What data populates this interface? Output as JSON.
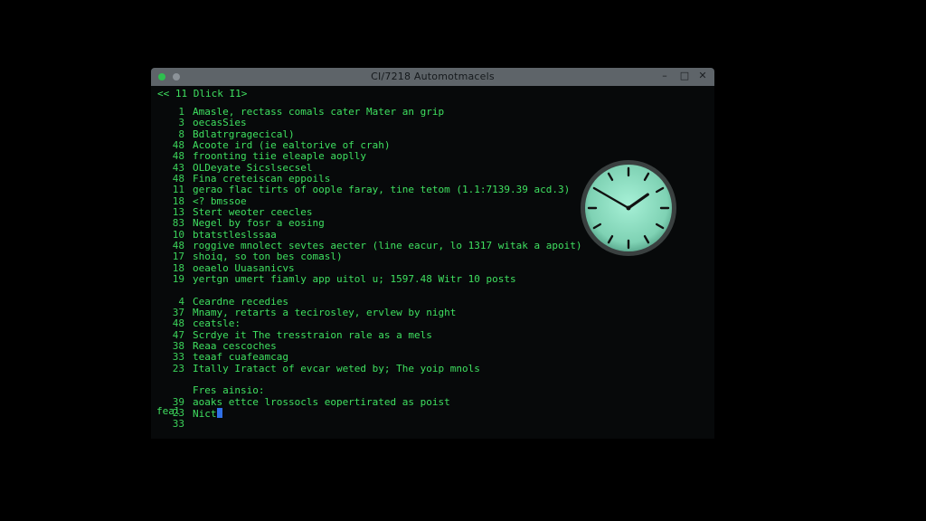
{
  "window": {
    "title": "CI/7218 Automotmacels",
    "controls": {
      "minimize": "–",
      "maximize": "□",
      "close": "✕"
    }
  },
  "terminal": {
    "header": "<< 11 Dlick I1>",
    "lines": [
      {
        "num": "1",
        "text": "Amasle, rectass comals cater Mater an grip"
      },
      {
        "num": "3",
        "text": "oecasSies"
      },
      {
        "num": "8",
        "text": "Bdlatrgragecical)"
      },
      {
        "num": "48",
        "text": "Acoote ird (ie ealtorive of crah)"
      },
      {
        "num": "48",
        "text": "froonting tiie eleaple aoplly"
      },
      {
        "num": "43",
        "text": "OLDeyate Sicslsecsel"
      },
      {
        "num": "48",
        "text": "Fina creteiscan eppoils"
      },
      {
        "num": "11",
        "text": "gerao flac tirts of oople faray, tine tetom (1.1:7139.39 acd.3)"
      },
      {
        "num": "18",
        "text": "<? bmssoe"
      },
      {
        "num": "13",
        "text": "Stert weoter ceecles"
      },
      {
        "num": "83",
        "text": "Negel by fosr a eosing"
      },
      {
        "num": "10",
        "text": "btatstleslssaa"
      },
      {
        "num": "48",
        "text": "roggive mnolect sevtes aecter (line eacur, lo 1317 witak a apoit)"
      },
      {
        "num": "17",
        "text": "shoiq, so ton bes comasl)"
      },
      {
        "num": "18",
        "text": "oeaelo Uuasanicvs"
      },
      {
        "num": "19",
        "text": "yertgn umert fiamly app uitol u; 1597.48 Witr 10 posts"
      },
      {
        "num": "",
        "text": ""
      },
      {
        "num": "4",
        "text": "Ceardne recedies"
      },
      {
        "num": "37",
        "text": "Mnamy, retarts a tecirosley, ervlew by night"
      },
      {
        "num": "48",
        "text": "ceatsle:"
      },
      {
        "num": "47",
        "text": "Scrdye it The tresstraion rale as a mels"
      },
      {
        "num": "38",
        "text": "Reaa cescoches"
      },
      {
        "num": "33",
        "text": "teaaf cuafeamcag"
      },
      {
        "num": "23",
        "text": "Itally Iratact of evcar weted by; The yoip mnols"
      },
      {
        "num": "",
        "text": ""
      },
      {
        "num": "",
        "text": "Fres ainsio:"
      },
      {
        "num": "39",
        "text": "aoaks ettce lrossocls eopertirated as poist"
      },
      {
        "num": "23",
        "text": "Nict"
      },
      {
        "num": "33",
        "text": ""
      }
    ],
    "footer": "feal"
  },
  "clock": {
    "hours": 1,
    "minutes": 50
  },
  "colors": {
    "terminal_text": "#3fe060",
    "cursor": "#2f6fe6",
    "clock_face": "#8fe0c2"
  }
}
